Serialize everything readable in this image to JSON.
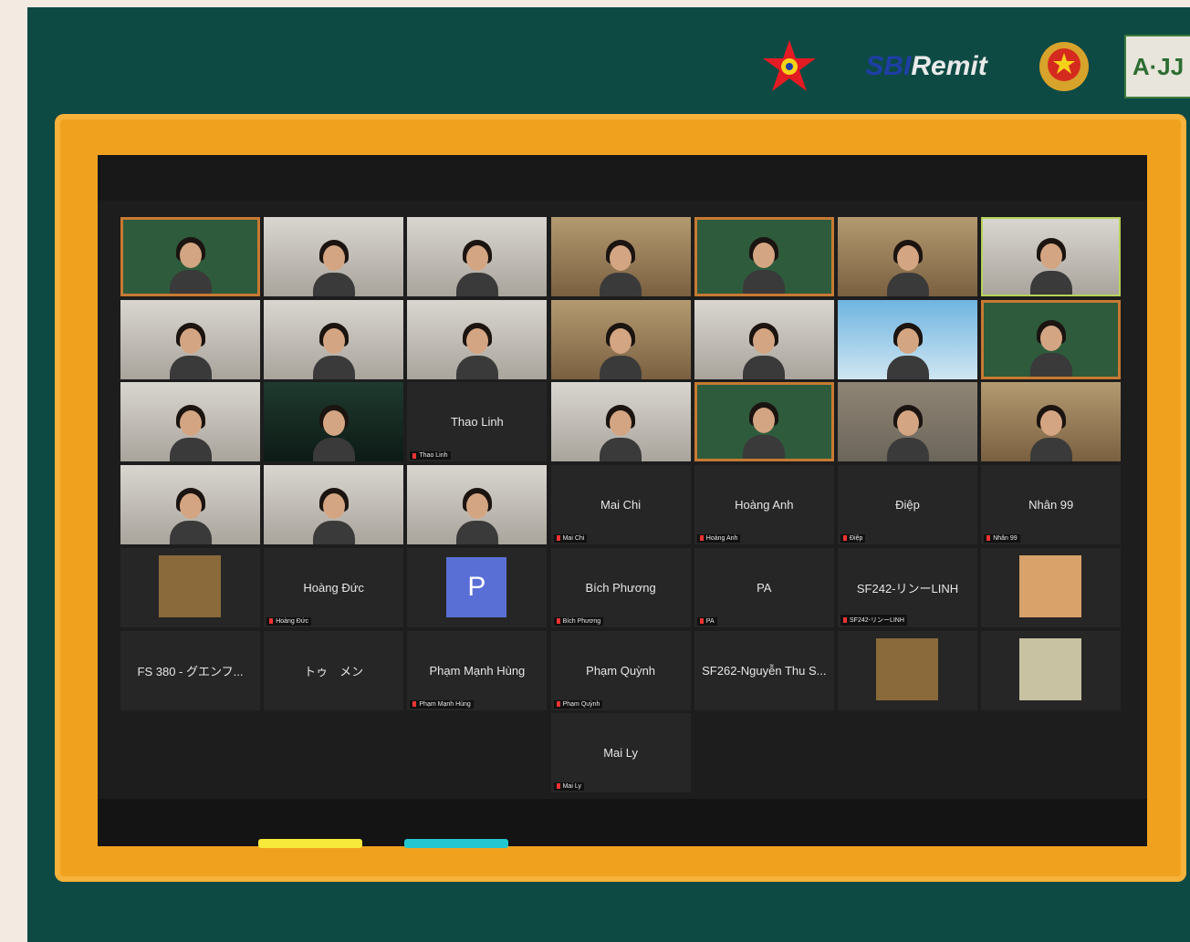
{
  "logos": {
    "sbi_part1": "SBI",
    "sbi_part2": "Remit",
    "aij_text": "A·JJ"
  },
  "participants": [
    {
      "label": "",
      "display_name": "",
      "type": "video"
    },
    {
      "label": "",
      "display_name": "",
      "type": "video"
    },
    {
      "label": "",
      "display_name": "",
      "type": "video"
    },
    {
      "label": "",
      "display_name": "",
      "type": "video"
    },
    {
      "label": "",
      "display_name": "",
      "type": "video"
    },
    {
      "label": "",
      "display_name": "",
      "type": "video"
    },
    {
      "label": "",
      "display_name": "",
      "type": "video"
    },
    {
      "label": "",
      "display_name": "",
      "type": "video"
    },
    {
      "label": "",
      "display_name": "",
      "type": "video"
    },
    {
      "label": "",
      "display_name": "",
      "type": "video"
    },
    {
      "label": "",
      "display_name": "",
      "type": "video"
    },
    {
      "label": "",
      "display_name": "",
      "type": "video"
    },
    {
      "label": "",
      "display_name": "",
      "type": "video"
    },
    {
      "label": "",
      "display_name": "",
      "type": "video"
    },
    {
      "label": "",
      "display_name": "",
      "type": "video"
    },
    {
      "label": "",
      "display_name": "",
      "type": "video"
    },
    {
      "label": "Thao Linh",
      "display_name": "Thao Linh",
      "type": "name"
    },
    {
      "label": "",
      "display_name": "",
      "type": "video"
    },
    {
      "label": "",
      "display_name": "",
      "type": "video"
    },
    {
      "label": "",
      "display_name": "",
      "type": "video"
    },
    {
      "label": "",
      "display_name": "",
      "type": "video"
    },
    {
      "label": "",
      "display_name": "",
      "type": "video"
    },
    {
      "label": "",
      "display_name": "",
      "type": "video"
    },
    {
      "label": "",
      "display_name": "",
      "type": "video"
    },
    {
      "label": "Mai Chi",
      "display_name": "Mai Chi",
      "type": "name"
    },
    {
      "label": "Hoàng Anh",
      "display_name": "Hoàng Anh",
      "type": "name"
    },
    {
      "label": "Điệp",
      "display_name": "Điệp",
      "type": "name"
    },
    {
      "label": "Nhân 99",
      "display_name": "Nhân 99",
      "type": "name"
    },
    {
      "label": "",
      "display_name": "",
      "type": "image"
    },
    {
      "label": "Hoàng Đức",
      "display_name": "Hoàng Đức",
      "type": "name"
    },
    {
      "label": "",
      "display_name": "",
      "type": "avatar",
      "initial": "P"
    },
    {
      "label": "Bích Phương",
      "display_name": "Bích Phương",
      "type": "name"
    },
    {
      "label": "PA",
      "display_name": "PA",
      "type": "name"
    },
    {
      "label": "SF242-リンーLINH",
      "display_name": "SF242-リンーLINH",
      "type": "name"
    },
    {
      "label": "",
      "display_name": "",
      "type": "image"
    },
    {
      "label": "",
      "display_name": "FS 380 - グエンフ...",
      "type": "name"
    },
    {
      "label": "",
      "display_name": "トゥ　メン",
      "type": "name"
    },
    {
      "label": "Phạm Mạnh Hùng",
      "display_name": "Phạm Mạnh Hùng",
      "type": "name"
    },
    {
      "label": "Phạm Quỳnh",
      "display_name": "Phạm Quỳnh",
      "type": "name"
    },
    {
      "label": "",
      "display_name": "SF262-Nguyễn Thu S...",
      "type": "name"
    },
    {
      "label": "",
      "display_name": "",
      "type": "image"
    },
    {
      "label": "",
      "display_name": "",
      "type": "image"
    },
    {
      "label": "Mai Ly",
      "display_name": "Mai Ly",
      "type": "name"
    }
  ],
  "colors": {
    "board": "#0e4a44",
    "frame": "#f0a21f",
    "screen": "#1d1d1d",
    "accent_yellow": "#f7ea3a",
    "accent_cyan": "#22c6cf"
  }
}
